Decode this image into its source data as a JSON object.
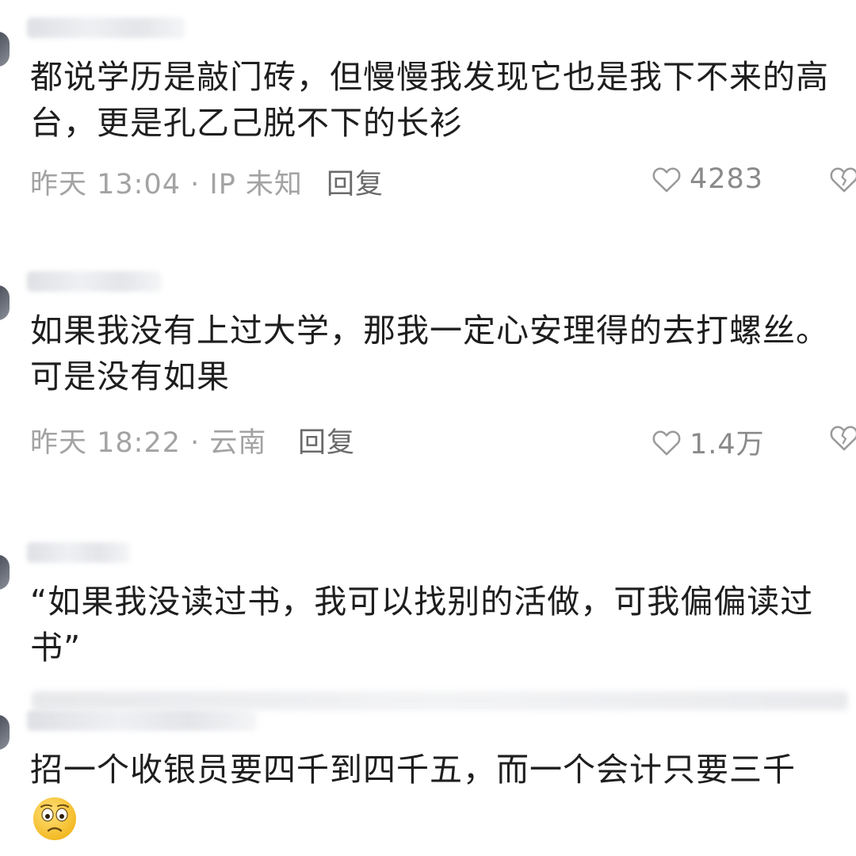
{
  "comments": [
    {
      "text": "都说学历是敲门砖，但慢慢我发现它也是我下不来的高台，更是孔乙己脱不下的长衫",
      "time": "昨天 13:04 · IP 未知",
      "reply": "回复",
      "likes": "4283"
    },
    {
      "text": "如果我没有上过大学，那我一定心安理得的去打螺丝。可是没有如果",
      "time": "昨天 18:22 · 云南",
      "reply": "回复",
      "likes": "1.4万"
    },
    {
      "text": "“如果我没读过书，我可以找别的活做，可我偏偏读过书”"
    },
    {
      "text": "招一个收银员要四千到四千五，而一个会计只要三千"
    }
  ],
  "icons": {
    "like": "heart-outline-icon",
    "dislike": "broken-heart-icon",
    "emoji": "worried-face-emoji"
  },
  "colors": {
    "text": "#1e1e1e",
    "meta": "#a3a3a3",
    "reply": "#6a6a6a",
    "icon": "#9a9a9a"
  }
}
